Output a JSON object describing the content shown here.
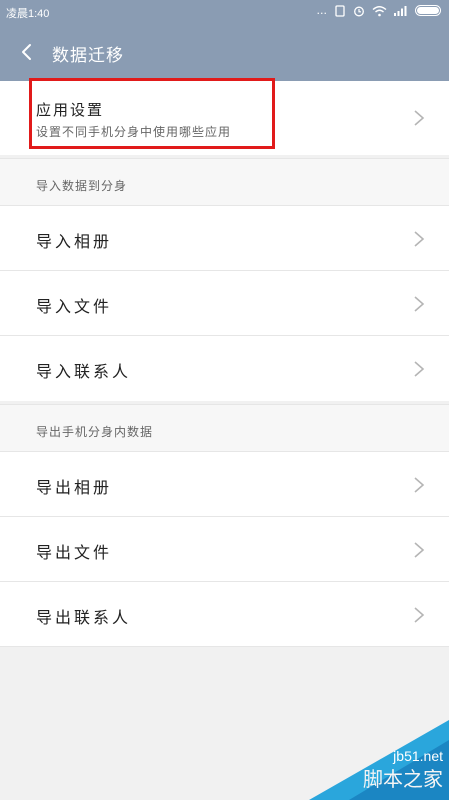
{
  "status": {
    "time": "凌晨1:40",
    "dots": "..."
  },
  "header": {
    "title": "数据迁移"
  },
  "app_settings": {
    "title": "应用设置",
    "subtitle": "设置不同手机分身中使用哪些应用"
  },
  "import_group": {
    "header": "导入数据到分身",
    "items": [
      {
        "label": "导入相册"
      },
      {
        "label": "导入文件"
      },
      {
        "label": "导入联系人"
      }
    ]
  },
  "export_group": {
    "header": "导出手机分身内数据",
    "items": [
      {
        "label": "导出相册"
      },
      {
        "label": "导出文件"
      },
      {
        "label": "导出联系人"
      }
    ]
  },
  "watermark": {
    "site": "jb51.net",
    "name": "脚本之家"
  },
  "colors": {
    "header_bg": "#8a9cb3",
    "highlight": "#e11a1a"
  }
}
